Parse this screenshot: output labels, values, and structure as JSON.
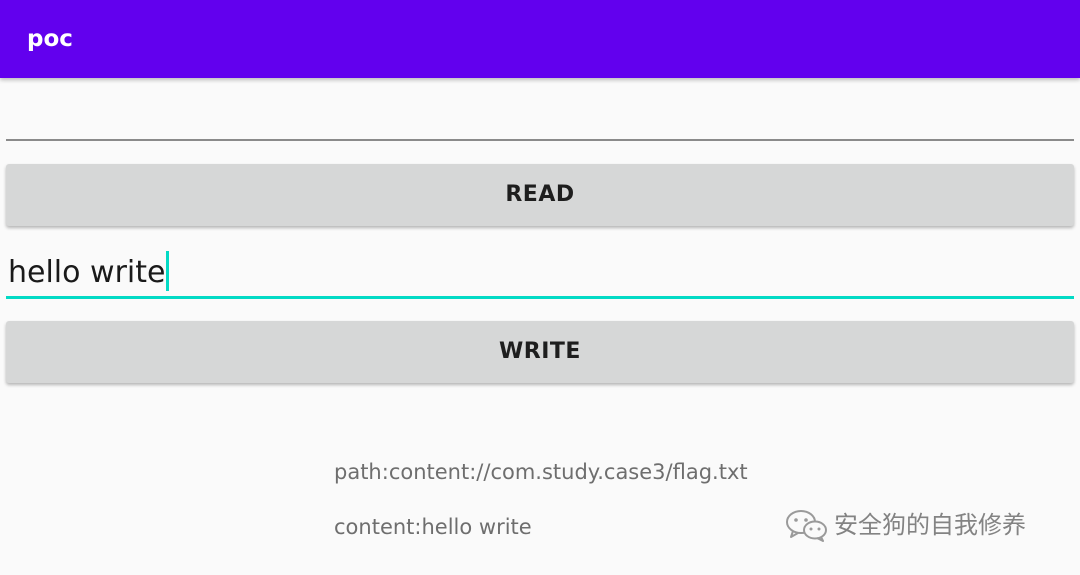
{
  "app_bar": {
    "title": "poc",
    "color": "#6200ee"
  },
  "read_section": {
    "input_value": "",
    "button_label": "READ"
  },
  "write_section": {
    "input_value": "hello write",
    "button_label": "WRITE",
    "accent_color": "#03dac5"
  },
  "output": {
    "path_text": "path:content://com.study.case3/flag.txt",
    "content_text": "content:hello write"
  },
  "watermark": {
    "icon": "wechat-icon",
    "text": "安全狗的自我修养"
  }
}
